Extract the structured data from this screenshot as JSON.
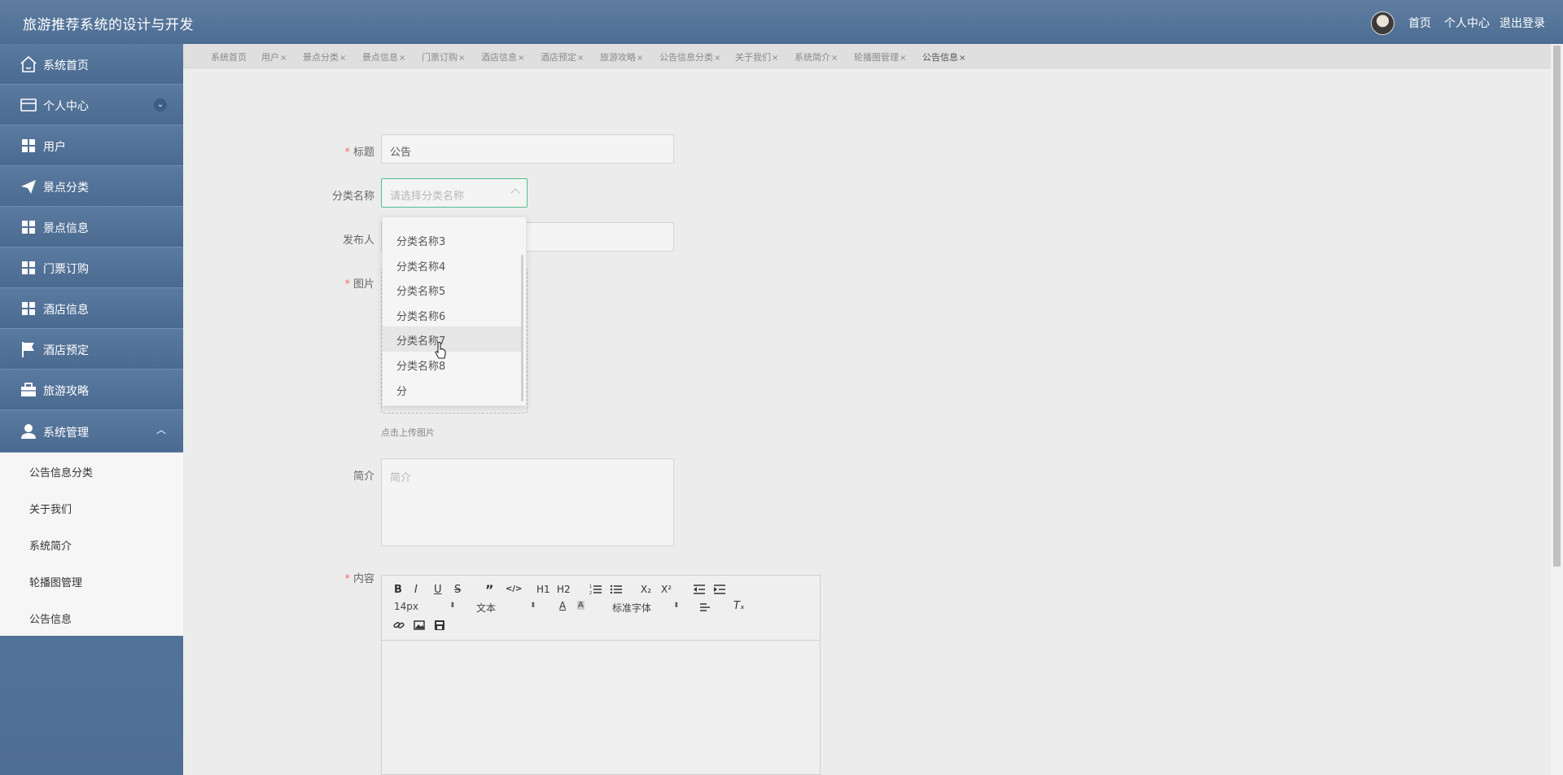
{
  "header": {
    "title": "旅游推荐系统的设计与开发",
    "links": [
      "首页",
      "个人中心",
      "退出登录"
    ]
  },
  "sidebar": {
    "items": [
      {
        "label": "系统首页",
        "icon": "home-icon"
      },
      {
        "label": "个人中心",
        "icon": "card-icon"
      },
      {
        "label": "用户",
        "icon": "grid-icon"
      },
      {
        "label": "景点分类",
        "icon": "paper-plane-icon"
      },
      {
        "label": "景点信息",
        "icon": "grid-icon"
      },
      {
        "label": "门票订购",
        "icon": "grid-icon"
      },
      {
        "label": "酒店信息",
        "icon": "grid-icon"
      },
      {
        "label": "酒店预定",
        "icon": "flag-icon"
      },
      {
        "label": "旅游攻略",
        "icon": "briefcase-icon"
      },
      {
        "label": "系统管理",
        "icon": "user-icon"
      }
    ],
    "submenu": [
      "公告信息分类",
      "关于我们",
      "系统简介",
      "轮播图管理",
      "公告信息"
    ]
  },
  "tabs": [
    "系统首页",
    "用户",
    "景点分类",
    "景点信息",
    "门票订购",
    "酒店信息",
    "酒店预定",
    "旅游攻略",
    "公告信息分类",
    "关于我们",
    "系统简介",
    "轮播图管理",
    "公告信息"
  ],
  "active_tab": "公告信息",
  "form": {
    "title_label": "标题",
    "title_value": "公告",
    "category_label": "分类名称",
    "category_placeholder": "请选择分类名称",
    "publisher_label": "发布人",
    "image_label": "图片",
    "upload_hint": "点击上传图片",
    "intro_label": "简介",
    "intro_placeholder": "简介",
    "content_label": "内容"
  },
  "dropdown": {
    "options": [
      "分类名称3",
      "分类名称4",
      "分类名称5",
      "分类名称6",
      "分类名称7",
      "分类名称8",
      "分"
    ],
    "hovered": "分类名称7"
  },
  "editor": {
    "font_size": "14px",
    "header_select": "文本",
    "font_family": "标准字体",
    "buttons": [
      "B",
      "I",
      "U",
      "S",
      "”",
      "</>",
      "H1",
      "H2",
      "ordered-list",
      "bullet-list",
      "X₂",
      "X²",
      "outdent",
      "indent"
    ]
  }
}
